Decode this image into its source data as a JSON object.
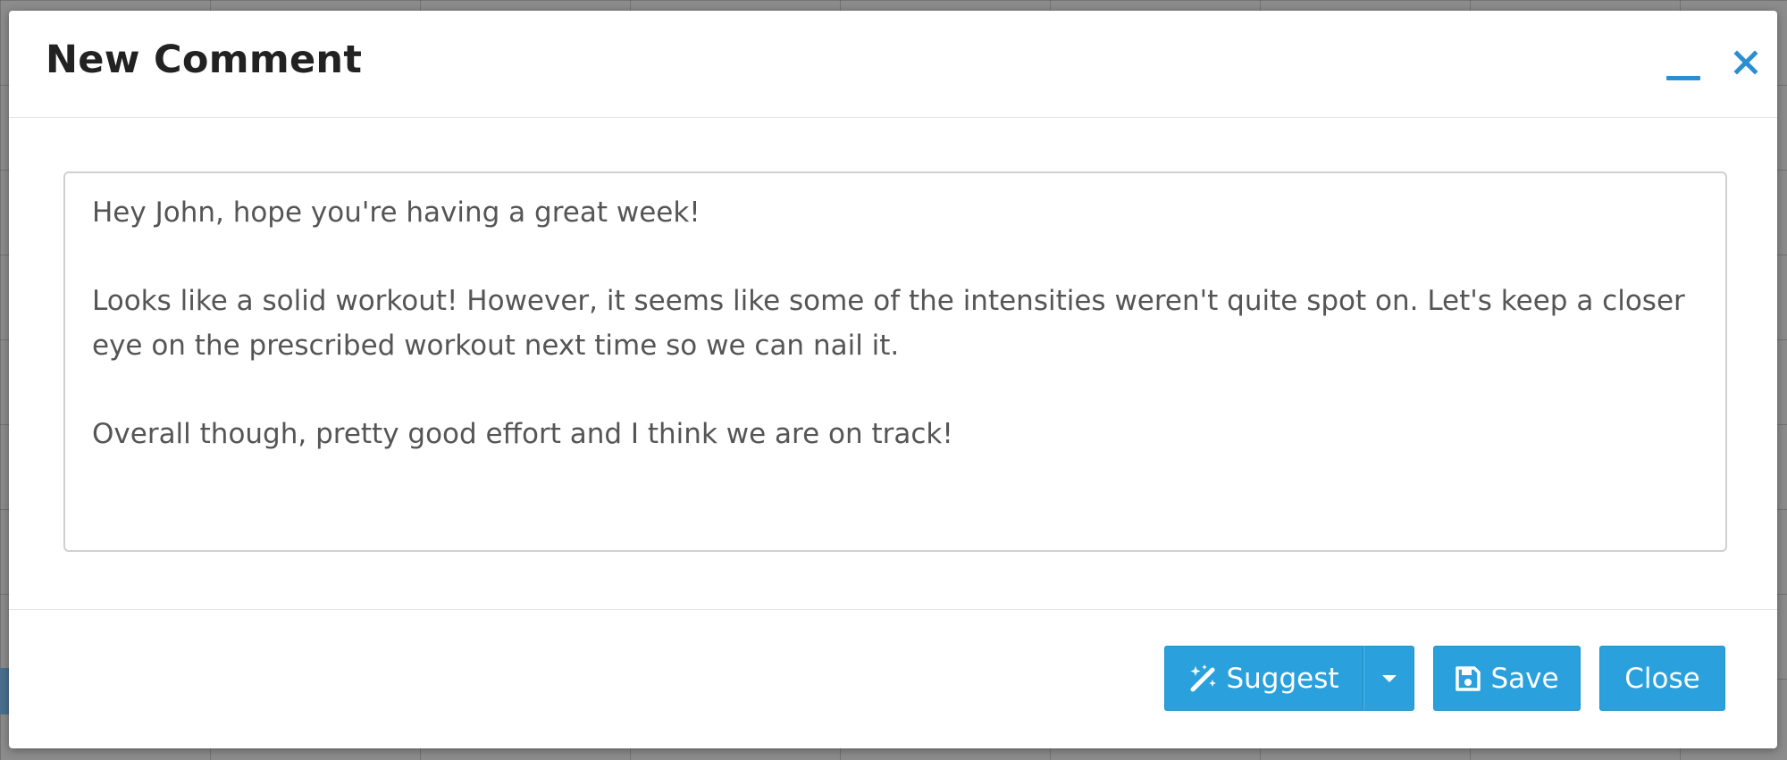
{
  "modal": {
    "title": "New Comment",
    "minimize_icon": "minimize-icon",
    "close_icon": "close-icon",
    "accent_color": "#2a8fd0"
  },
  "comment": {
    "text": "Hey John, hope you're having a great week!\n\nLooks like a solid workout! However, it seems like some of the intensities weren't quite spot on. Let's keep a closer eye on the prescribed workout next time so we can nail it.\n\nOverall though, pretty good effort and I think we are on track!"
  },
  "footer": {
    "suggest_label": "Suggest",
    "suggest_icon": "magic-wand-icon",
    "suggest_dropdown_icon": "caret-down-icon",
    "save_label": "Save",
    "save_icon": "floppy-disk-icon",
    "close_label": "Close",
    "button_color": "#2aa1dc"
  }
}
